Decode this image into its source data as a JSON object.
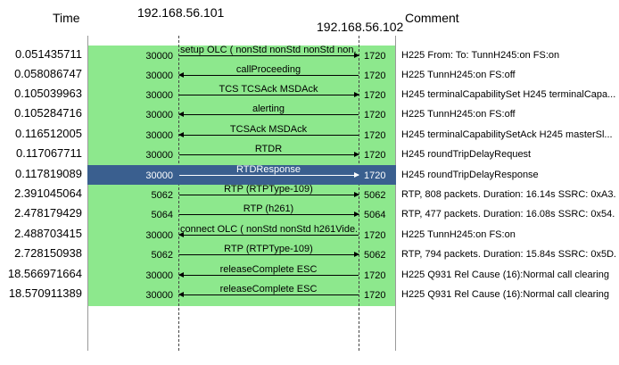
{
  "header": {
    "time_label": "Time",
    "host_a": "192.168.56.101",
    "host_b": "192.168.56.102",
    "comment_label": "Comment"
  },
  "rows": [
    {
      "time": "0.051435711",
      "lport": "30000",
      "rport": "1720",
      "label": "setup OLC ( nonStd nonStd nonStd non...",
      "dir": "r",
      "comment": "H225 From:  To:  TunnH245:on FS:on",
      "selected": false,
      "align": "left"
    },
    {
      "time": "0.058086747",
      "lport": "30000",
      "rport": "1720",
      "label": "callProceeding",
      "dir": "l",
      "comment": "H225 TunnH245:on FS:off",
      "selected": false
    },
    {
      "time": "0.105039963",
      "lport": "30000",
      "rport": "1720",
      "label": "TCS TCSAck MSDAck",
      "dir": "r",
      "comment": "H245 terminalCapabilitySet H245 terminalCapa...",
      "selected": false
    },
    {
      "time": "0.105284716",
      "lport": "30000",
      "rport": "1720",
      "label": "alerting",
      "dir": "l",
      "comment": "H225 TunnH245:on FS:off",
      "selected": false
    },
    {
      "time": "0.116512005",
      "lport": "30000",
      "rport": "1720",
      "label": "TCSAck MSDAck",
      "dir": "l",
      "comment": "H245 terminalCapabilitySetAck H245 masterSl...",
      "selected": false
    },
    {
      "time": "0.117067711",
      "lport": "30000",
      "rport": "1720",
      "label": "RTDR",
      "dir": "r",
      "comment": "H245 roundTripDelayRequest",
      "selected": false
    },
    {
      "time": "0.117819089",
      "lport": "30000",
      "rport": "1720",
      "label": "RTDResponse",
      "dir": "r",
      "comment": "H245 roundTripDelayResponse",
      "selected": true
    },
    {
      "time": "2.391045064",
      "lport": "5062",
      "rport": "5062",
      "label": "RTP (RTPType-109)",
      "dir": "r",
      "comment": "RTP, 808 packets. Duration: 16.14s SSRC: 0xA3...",
      "selected": false
    },
    {
      "time": "2.478179429",
      "lport": "5064",
      "rport": "5064",
      "label": "RTP (h261)",
      "dir": "r",
      "comment": "RTP, 477 packets. Duration: 16.08s SSRC: 0x54...",
      "selected": false
    },
    {
      "time": "2.488703415",
      "lport": "30000",
      "rport": "1720",
      "label": "connect OLC ( nonStd nonStd h261Vide...",
      "dir": "l",
      "comment": "H225 TunnH245:on FS:on",
      "selected": false,
      "align": "left"
    },
    {
      "time": "2.728150938",
      "lport": "5062",
      "rport": "5062",
      "label": "RTP (RTPType-109)",
      "dir": "r",
      "comment": "RTP, 794 packets. Duration: 15.84s SSRC: 0x5D...",
      "selected": false
    },
    {
      "time": "18.566971664",
      "lport": "30000",
      "rport": "1720",
      "label": "releaseComplete ESC",
      "dir": "l",
      "comment": "H225 Q931 Rel Cause (16):Normal call clearing",
      "selected": false
    },
    {
      "time": "18.570911389",
      "lport": "30000",
      "rport": "1720",
      "label": "releaseComplete ESC",
      "dir": "l",
      "comment": "H225 Q931 Rel Cause (16):Normal call clearing",
      "selected": false
    }
  ],
  "colors": {
    "flow_background": "#8de88d",
    "selected_row": "#3a5f8f"
  }
}
